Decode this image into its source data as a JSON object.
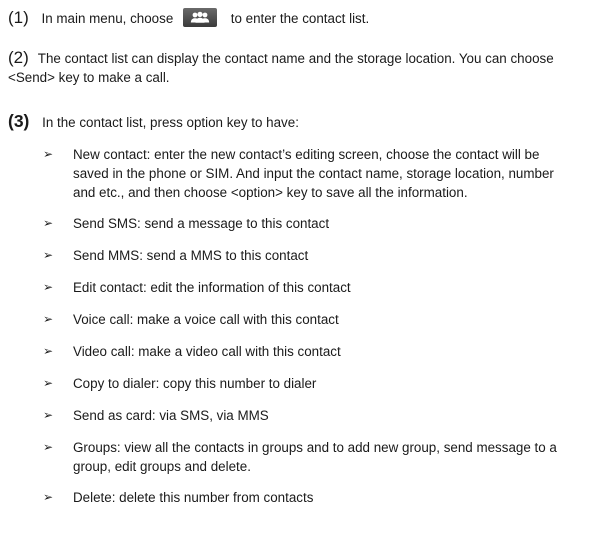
{
  "steps": [
    {
      "number": "(1)",
      "text_before_icon": "In main menu, choose",
      "icon": "contacts-icon",
      "text_after_icon": "to enter the contact list."
    },
    {
      "number": "(2)",
      "text": "The contact list can display the contact name and the storage location. You can choose <Send> key to make a call."
    },
    {
      "number": "(3)",
      "text": "In the contact list, press option key to have:"
    }
  ],
  "bullet_symbol": "➢",
  "options": [
    "New contact: enter the new contact’s editing screen, choose the contact will be saved in the phone or SIM. And input the contact name, storage location, number and etc., and then choose <option> key to save all the information.",
    "Send SMS: send a message to this contact",
    "Send MMS: send a MMS to this contact",
    "Edit contact: edit the information of this contact",
    "Voice call: make a voice call with this contact",
    "Video call: make a video call with this contact",
    "Copy to dialer: copy this number to dialer",
    "Send as card: via SMS, via MMS",
    "Groups: view all the contacts in groups and to add new group, send message to a group, edit groups and delete.",
    "Delete: delete this number from contacts"
  ]
}
